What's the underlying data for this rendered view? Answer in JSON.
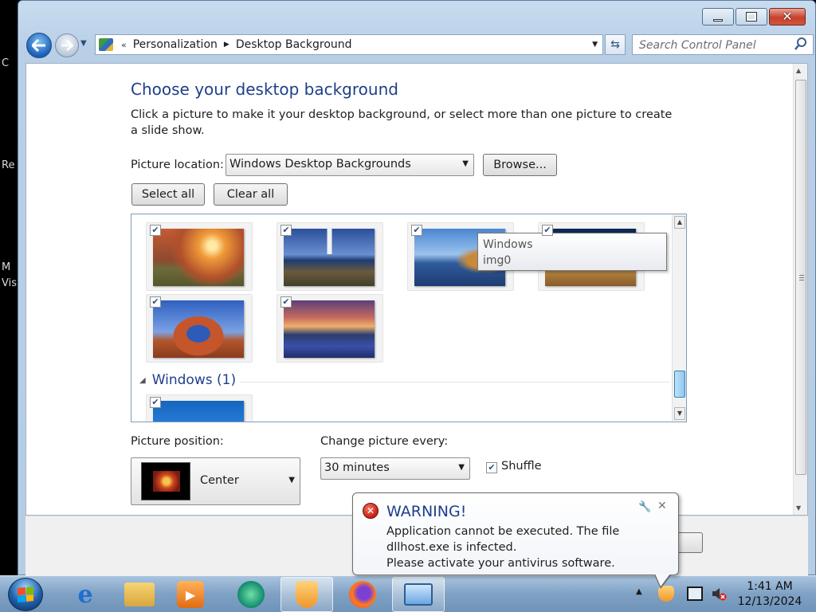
{
  "desktop_fragments": [
    "C",
    "Re",
    "M",
    "Vis"
  ],
  "window": {
    "controls": {
      "minimize": "minimize",
      "maximize": "maximize",
      "close": "close"
    }
  },
  "address": {
    "root_sep": "«",
    "crumbs": [
      "Personalization",
      "Desktop Background"
    ]
  },
  "search": {
    "placeholder": "Search Control Panel"
  },
  "page": {
    "title": "Choose your desktop background",
    "description": "Click a picture to make it your desktop background, or select more than one picture to create a slide show.",
    "location_label": "Picture location:",
    "location_value": "Windows Desktop Backgrounds",
    "browse_label": "Browse...",
    "select_all_label": "Select all",
    "clear_all_label": "Clear all"
  },
  "gallery": {
    "group_header": "Windows (1)",
    "tooltip": {
      "line1": "Windows",
      "line2": "img0"
    },
    "tiles_checked": true
  },
  "options": {
    "position_label": "Picture position:",
    "position_value": "Center",
    "interval_label": "Change picture every:",
    "interval_value": "30 minutes",
    "shuffle_label": "Shuffle",
    "shuffle_checked": true
  },
  "balloon": {
    "title": "WARNING!",
    "message_line1": "Application cannot be executed. The file dllhost.exe is infected.",
    "message_line2": "Please activate your antivirus software."
  },
  "taskbar": {
    "apps": [
      "internet-explorer",
      "file-explorer",
      "media-player",
      "app-green",
      "security-shield",
      "firefox",
      "control-panel"
    ],
    "clock_time": "1:41 AM",
    "clock_date": "12/13/2024"
  }
}
